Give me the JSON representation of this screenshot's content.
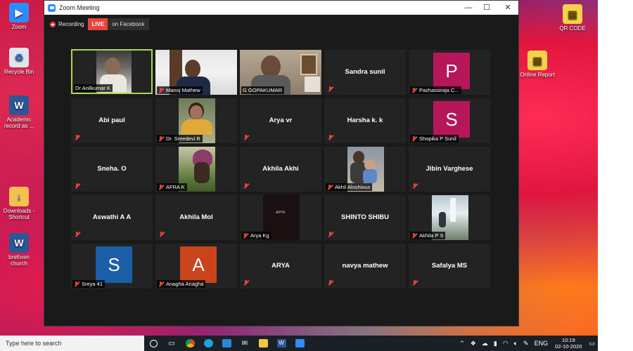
{
  "desktop": {
    "icons_left": [
      {
        "label": "Zoom",
        "icon": "zoom-app-icon"
      },
      {
        "label": "Recycle Bin",
        "icon": "recycle-bin-icon"
      },
      {
        "label": "Academic record as ...",
        "icon": "word-document-icon"
      },
      {
        "label": "Downloads - Shortcut",
        "icon": "downloads-folder-icon"
      },
      {
        "label": "brethren church",
        "icon": "word-document-icon"
      }
    ],
    "icons_right": [
      {
        "label": "QR CODE",
        "icon": "zip-archive-icon"
      },
      {
        "label": "Online Report",
        "icon": "zip-archive-icon"
      }
    ]
  },
  "zoom": {
    "window_title": "Zoom Meeting",
    "recording_label": "Recording",
    "live_label": "LIVE",
    "live_target": "on Facebook",
    "accent_active_speaker": "#a7d94a",
    "muted_color": "#e8453c",
    "participants": [
      {
        "name": "Dr Anilkumar K",
        "video": true,
        "active": true,
        "muted": false
      },
      {
        "name": "Manoj Mathew",
        "video": true,
        "muted": true
      },
      {
        "name": "G GOPAKUMAR",
        "video": true,
        "muted": false
      },
      {
        "name": "Sandra sunil",
        "video": false,
        "muted": true
      },
      {
        "name": "Pazhassiraja C...",
        "avatar_letter": "P",
        "avatar_color": "#b5175a",
        "muted": true
      },
      {
        "name": "Abi paul",
        "video": false,
        "muted": true
      },
      {
        "name": "Dr. Sreedevi R",
        "video": true,
        "muted": true
      },
      {
        "name": "Arya vr",
        "video": false,
        "muted": true
      },
      {
        "name": "Harsha k. k",
        "video": false,
        "muted": true
      },
      {
        "name": "Shopika P Sunil",
        "avatar_letter": "S",
        "avatar_color": "#b5175a",
        "muted": true
      },
      {
        "name": "Sneha. O",
        "video": false,
        "muted": true
      },
      {
        "name": "AFRA K",
        "video": true,
        "muted": true
      },
      {
        "name": "Akhila Akhi",
        "video": false,
        "muted": true
      },
      {
        "name": "Akhil Aloshious",
        "video": true,
        "muted": true
      },
      {
        "name": "Jibin Varghese",
        "video": false,
        "muted": true
      },
      {
        "name": "Aswathi A A",
        "video": false,
        "muted": true
      },
      {
        "name": "Akhila Mol",
        "video": false,
        "muted": true
      },
      {
        "name": "Arya Kg",
        "video": true,
        "muted": true
      },
      {
        "name": "SHINTO SHIBU",
        "video": false,
        "muted": true
      },
      {
        "name": "Akhila P S",
        "video": true,
        "muted": true
      },
      {
        "name": "Sreya 41",
        "avatar_letter": "S",
        "avatar_color": "#1a5fa8",
        "muted": true
      },
      {
        "name": "Anagha Anagha",
        "avatar_letter": "A",
        "avatar_color": "#c9441a",
        "muted": true
      },
      {
        "name": "ARYA",
        "video": false,
        "muted": true
      },
      {
        "name": "navya mathew",
        "video": false,
        "muted": true
      },
      {
        "name": "Safalya MS",
        "video": false,
        "muted": true
      }
    ]
  },
  "taskbar": {
    "search_placeholder": "Type here to search",
    "pinned_icons": [
      "start-circle-icon",
      "task-view-icon",
      "chrome-icon",
      "edge-icon",
      "store-icon",
      "mail-icon",
      "file-explorer-icon",
      "word-icon",
      "zoom-icon"
    ],
    "language": "ENG",
    "time": "10:19",
    "date": "02-10-2020"
  }
}
